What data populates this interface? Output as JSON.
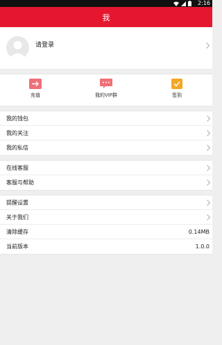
{
  "status_bar": {
    "time": "2:16"
  },
  "header": {
    "title": "我"
  },
  "profile": {
    "login_text": "请登录"
  },
  "actions": [
    {
      "label": "充值",
      "icon": "recharge-icon",
      "color": "#f06f78"
    },
    {
      "label": "我的VIP群",
      "icon": "chat-icon",
      "color": "#f06f78"
    },
    {
      "label": "签到",
      "icon": "checkin-icon",
      "color": "#f5a623"
    }
  ],
  "group1": [
    {
      "label": "我的钱包"
    },
    {
      "label": "我的关注"
    },
    {
      "label": "我的私信"
    }
  ],
  "group2": [
    {
      "label": "在线客服"
    },
    {
      "label": "客服与帮助"
    }
  ],
  "group3": [
    {
      "label": "提醒设置"
    },
    {
      "label": "关于我们"
    },
    {
      "label": "清除缓存",
      "value": "0.14MB"
    },
    {
      "label": "当前版本",
      "value": "1.0.0"
    }
  ],
  "colors": {
    "brand": "#e4172f",
    "background": "#efefef"
  }
}
